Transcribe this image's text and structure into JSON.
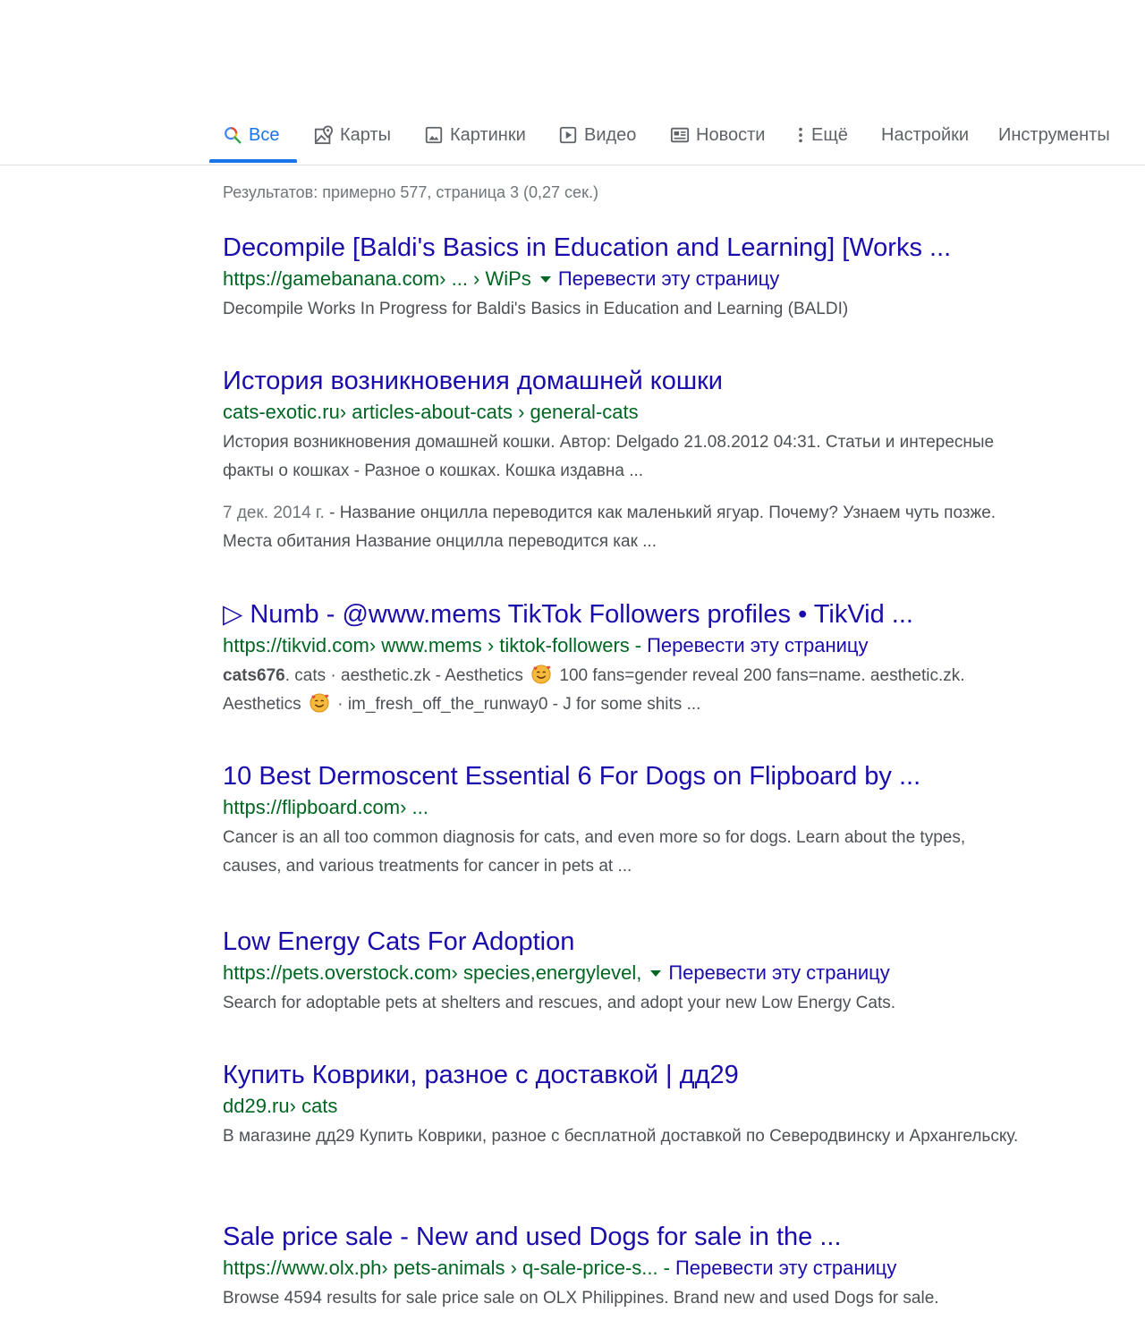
{
  "tabs": [
    {
      "label": "Все",
      "icon": "search-icon"
    },
    {
      "label": "Карты",
      "icon": "map-pin-icon"
    },
    {
      "label": "Картинки",
      "icon": "image-icon"
    },
    {
      "label": "Видео",
      "icon": "video-play-icon"
    },
    {
      "label": "Новости",
      "icon": "news-icon"
    },
    {
      "label": "Ещё",
      "icon": "more-vertical-icon"
    },
    {
      "label": "Настройки"
    },
    {
      "label": "Инструменты"
    }
  ],
  "stats": "Результатов: примерно 577, страница 3 (0,27 сек.)",
  "results": [
    {
      "title": "Decompile [Baldi's Basics in Education and Learning] [Works ...",
      "url_host": "https://gamebanana.com",
      "url_path": " › ... › WiPs",
      "translate": "Перевести эту страницу",
      "snippet": "Decompile Works In Progress for Baldi's Basics in Education and Learning (BALDI)"
    },
    {
      "title": "История возникновения домашней кошки",
      "url_host": "cats-exotic.ru",
      "url_path": " › articles-about-cats › general-cats",
      "snippet": "История возникновения домашней кошки. Автор: Delgado 21.08.2012 04:31. Статьи и интересные факты о кошках - Разное о кошках. Кошка издавна ...",
      "snippet2_date": "7 дек. 2014 г.",
      "snippet2": " - Название онцилла переводится как маленький ягуар. Почему? Узнаем чуть позже. Места обитания Название онцилла переводится как ..."
    },
    {
      "title_prefix": "▷",
      "title": "Numb - @www.mems TikTok Followers profiles • TikVid ...",
      "url_host": "https://tikvid.com",
      "url_path": " › www.mems › tiktok-followers",
      "translate": "Перевести эту страницу",
      "snippet_bold": "cats676",
      "snippet_a": ". cats · aesthetic.zk - Aesthetics",
      "snippet_b": "100 fans=gender reveal 200 fans=name. aesthetic.zk. Aesthetics",
      "snippet_c": "· im_fresh_off_the_runway0 - J for some shits ..."
    },
    {
      "title": "10 Best Dermoscent Essential 6 For Dogs on Flipboard by ...",
      "url_host": "https://flipboard.com",
      "url_path": " › ...",
      "snippet": "Cancer is an all too common diagnosis for cats, and even more so for dogs. Learn about the types, causes, and various treatments for cancer in pets at ..."
    },
    {
      "title": "Low Energy Cats For Adoption",
      "url_host": "https://pets.overstock.com",
      "url_path": " › species,energylevel,",
      "translate": "Перевести эту страницу",
      "snippet": "Search for adoptable pets at shelters and rescues, and adopt your new Low Energy Cats."
    },
    {
      "title": "Купить Коврики, разное с доставкой | дд29",
      "url_host": "dd29.ru",
      "url_path": " › cats",
      "snippet": "В магазине дд29 Купить Коврики, разное с бесплатной доставкой по Северодвинску и Архангельску."
    },
    {
      "title": "Sale price sale - New and used Dogs for sale in the ...",
      "url_host": "https://www.olx.ph",
      "url_path": " › pets-animals › q-sale-price-s...",
      "translate": "Перевести эту страницу",
      "snippet": "Browse 4594 results for sale price sale on OLX Philippines. Brand new and used Dogs for sale."
    }
  ],
  "colors": {
    "link": "#1a0dab",
    "url": "#006621",
    "active_tab": "#1a73e8"
  }
}
